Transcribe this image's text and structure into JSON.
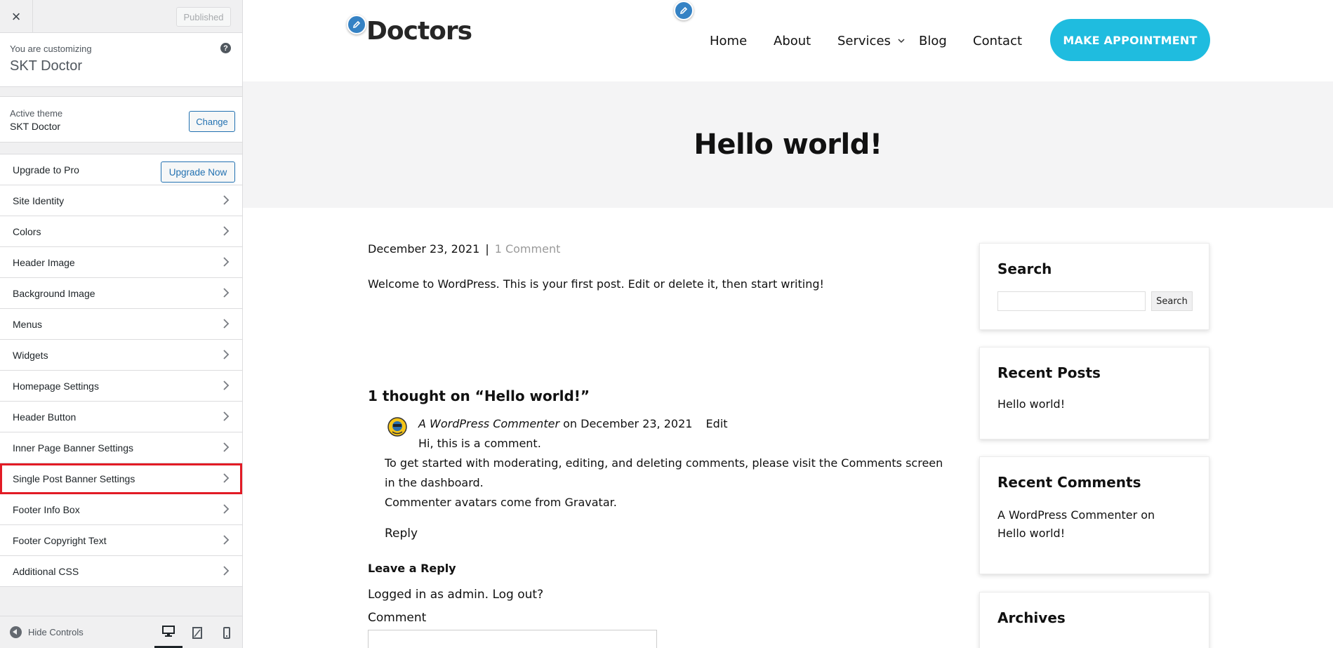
{
  "sidebar": {
    "close_label": "×",
    "published_label": "Published",
    "customizing_label": "You are customizing",
    "site_title": "SKT Doctor",
    "help_label": "?",
    "active_theme_label": "Active theme",
    "active_theme_name": "SKT Doctor",
    "change_label": "Change",
    "upgrade_row_label": "Upgrade to Pro",
    "upgrade_button_label": "Upgrade Now",
    "panels": [
      "Site Identity",
      "Colors",
      "Header Image",
      "Background Image",
      "Menus",
      "Widgets",
      "Homepage Settings",
      "Header Button",
      "Inner Page Banner Settings",
      "Single Post Banner Settings",
      "Footer Info Box",
      "Footer Copyright Text",
      "Additional CSS"
    ],
    "highlighted_panel": "Single Post Banner Settings",
    "hide_controls_label": "Hide Controls",
    "devices": [
      "desktop-icon",
      "tablet-icon",
      "mobile-icon"
    ],
    "active_device": "desktop-icon"
  },
  "site": {
    "logo_text": "Doctors",
    "nav": [
      "Home",
      "About",
      "Services",
      "Blog",
      "Contact"
    ],
    "cta_label": "MAKE APPOINTMENT",
    "accent": "#1fbcdf",
    "banner_title": "Hello world!"
  },
  "post": {
    "date": "December 23, 2021",
    "separator": "|",
    "comment_count": "1 Comment",
    "body": "Welcome to WordPress. This is your first post. Edit or delete it, then start writing!",
    "thoughts_heading": "1 thought on “Hello world!”",
    "comment": {
      "author": "A WordPress Commenter",
      "on": "on",
      "date": "December 23, 2021",
      "edit": "Edit",
      "line1": "Hi, this is a comment.",
      "line2": "To get started with moderating, editing, and deleting comments, please visit the Comments screen",
      "line3": "in the dashboard.",
      "line4_prefix": "Commenter avatars come from ",
      "line4_link": "Gravatar",
      "line4_suffix": "."
    },
    "reply_label": "Reply",
    "leave_reply_heading": "Leave a Reply",
    "logged_in_text": "Logged in as admin. Log out?",
    "comment_label": "Comment"
  },
  "widgets": {
    "search_title": "Search",
    "search_button": "Search",
    "recent_posts_title": "Recent Posts",
    "recent_posts": [
      "Hello world!"
    ],
    "recent_comments_title": "Recent Comments",
    "recent_comment_author": "A WordPress Commenter",
    "recent_comment_on": "on",
    "recent_comment_post": "Hello world!",
    "archives_title": "Archives"
  }
}
